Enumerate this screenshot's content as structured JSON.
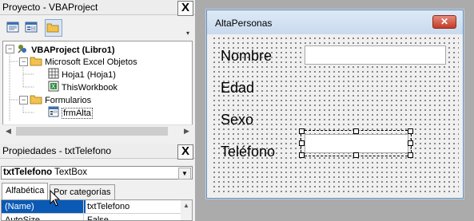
{
  "project_panel": {
    "title": "Proyecto - VBAProject",
    "close_label": "X",
    "tree": [
      {
        "label": "VBAProject (Libro1)",
        "expander": "−",
        "icon": "vba-project-icon",
        "bold": true
      },
      {
        "label": "Microsoft Excel Objetos",
        "expander": "−",
        "icon": "folder-icon"
      },
      {
        "label": "Hoja1 (Hoja1)",
        "icon": "worksheet-icon"
      },
      {
        "label": "ThisWorkbook",
        "icon": "workbook-icon"
      },
      {
        "label": "Formularios",
        "expander": "−",
        "icon": "folder-icon"
      },
      {
        "label": "frmAlta",
        "icon": "userform-icon",
        "selected": true
      }
    ]
  },
  "properties_panel": {
    "title": "Propiedades - txtTelefono",
    "close_label": "X",
    "object_name": "txtTelefono",
    "object_type": "TextBox",
    "tabs": [
      {
        "label": "Alfabética",
        "active": true
      },
      {
        "label": "Por categorías",
        "active": false
      }
    ],
    "rows": [
      {
        "name": "(Name)",
        "value": "txtTelefono",
        "selected": true
      },
      {
        "name": "AutoSize",
        "value": "False"
      }
    ]
  },
  "form": {
    "title": "AltaPersonas",
    "close_label": "✕",
    "labels": {
      "nombre": "Nombre",
      "edad": "Edad",
      "sexo": "Sexo",
      "telefono": "Teléfono"
    },
    "colors": {
      "selected_row": "#0a5ab5",
      "title_gradient_top": "#dde9f6",
      "close_red": "#c43b28"
    }
  }
}
